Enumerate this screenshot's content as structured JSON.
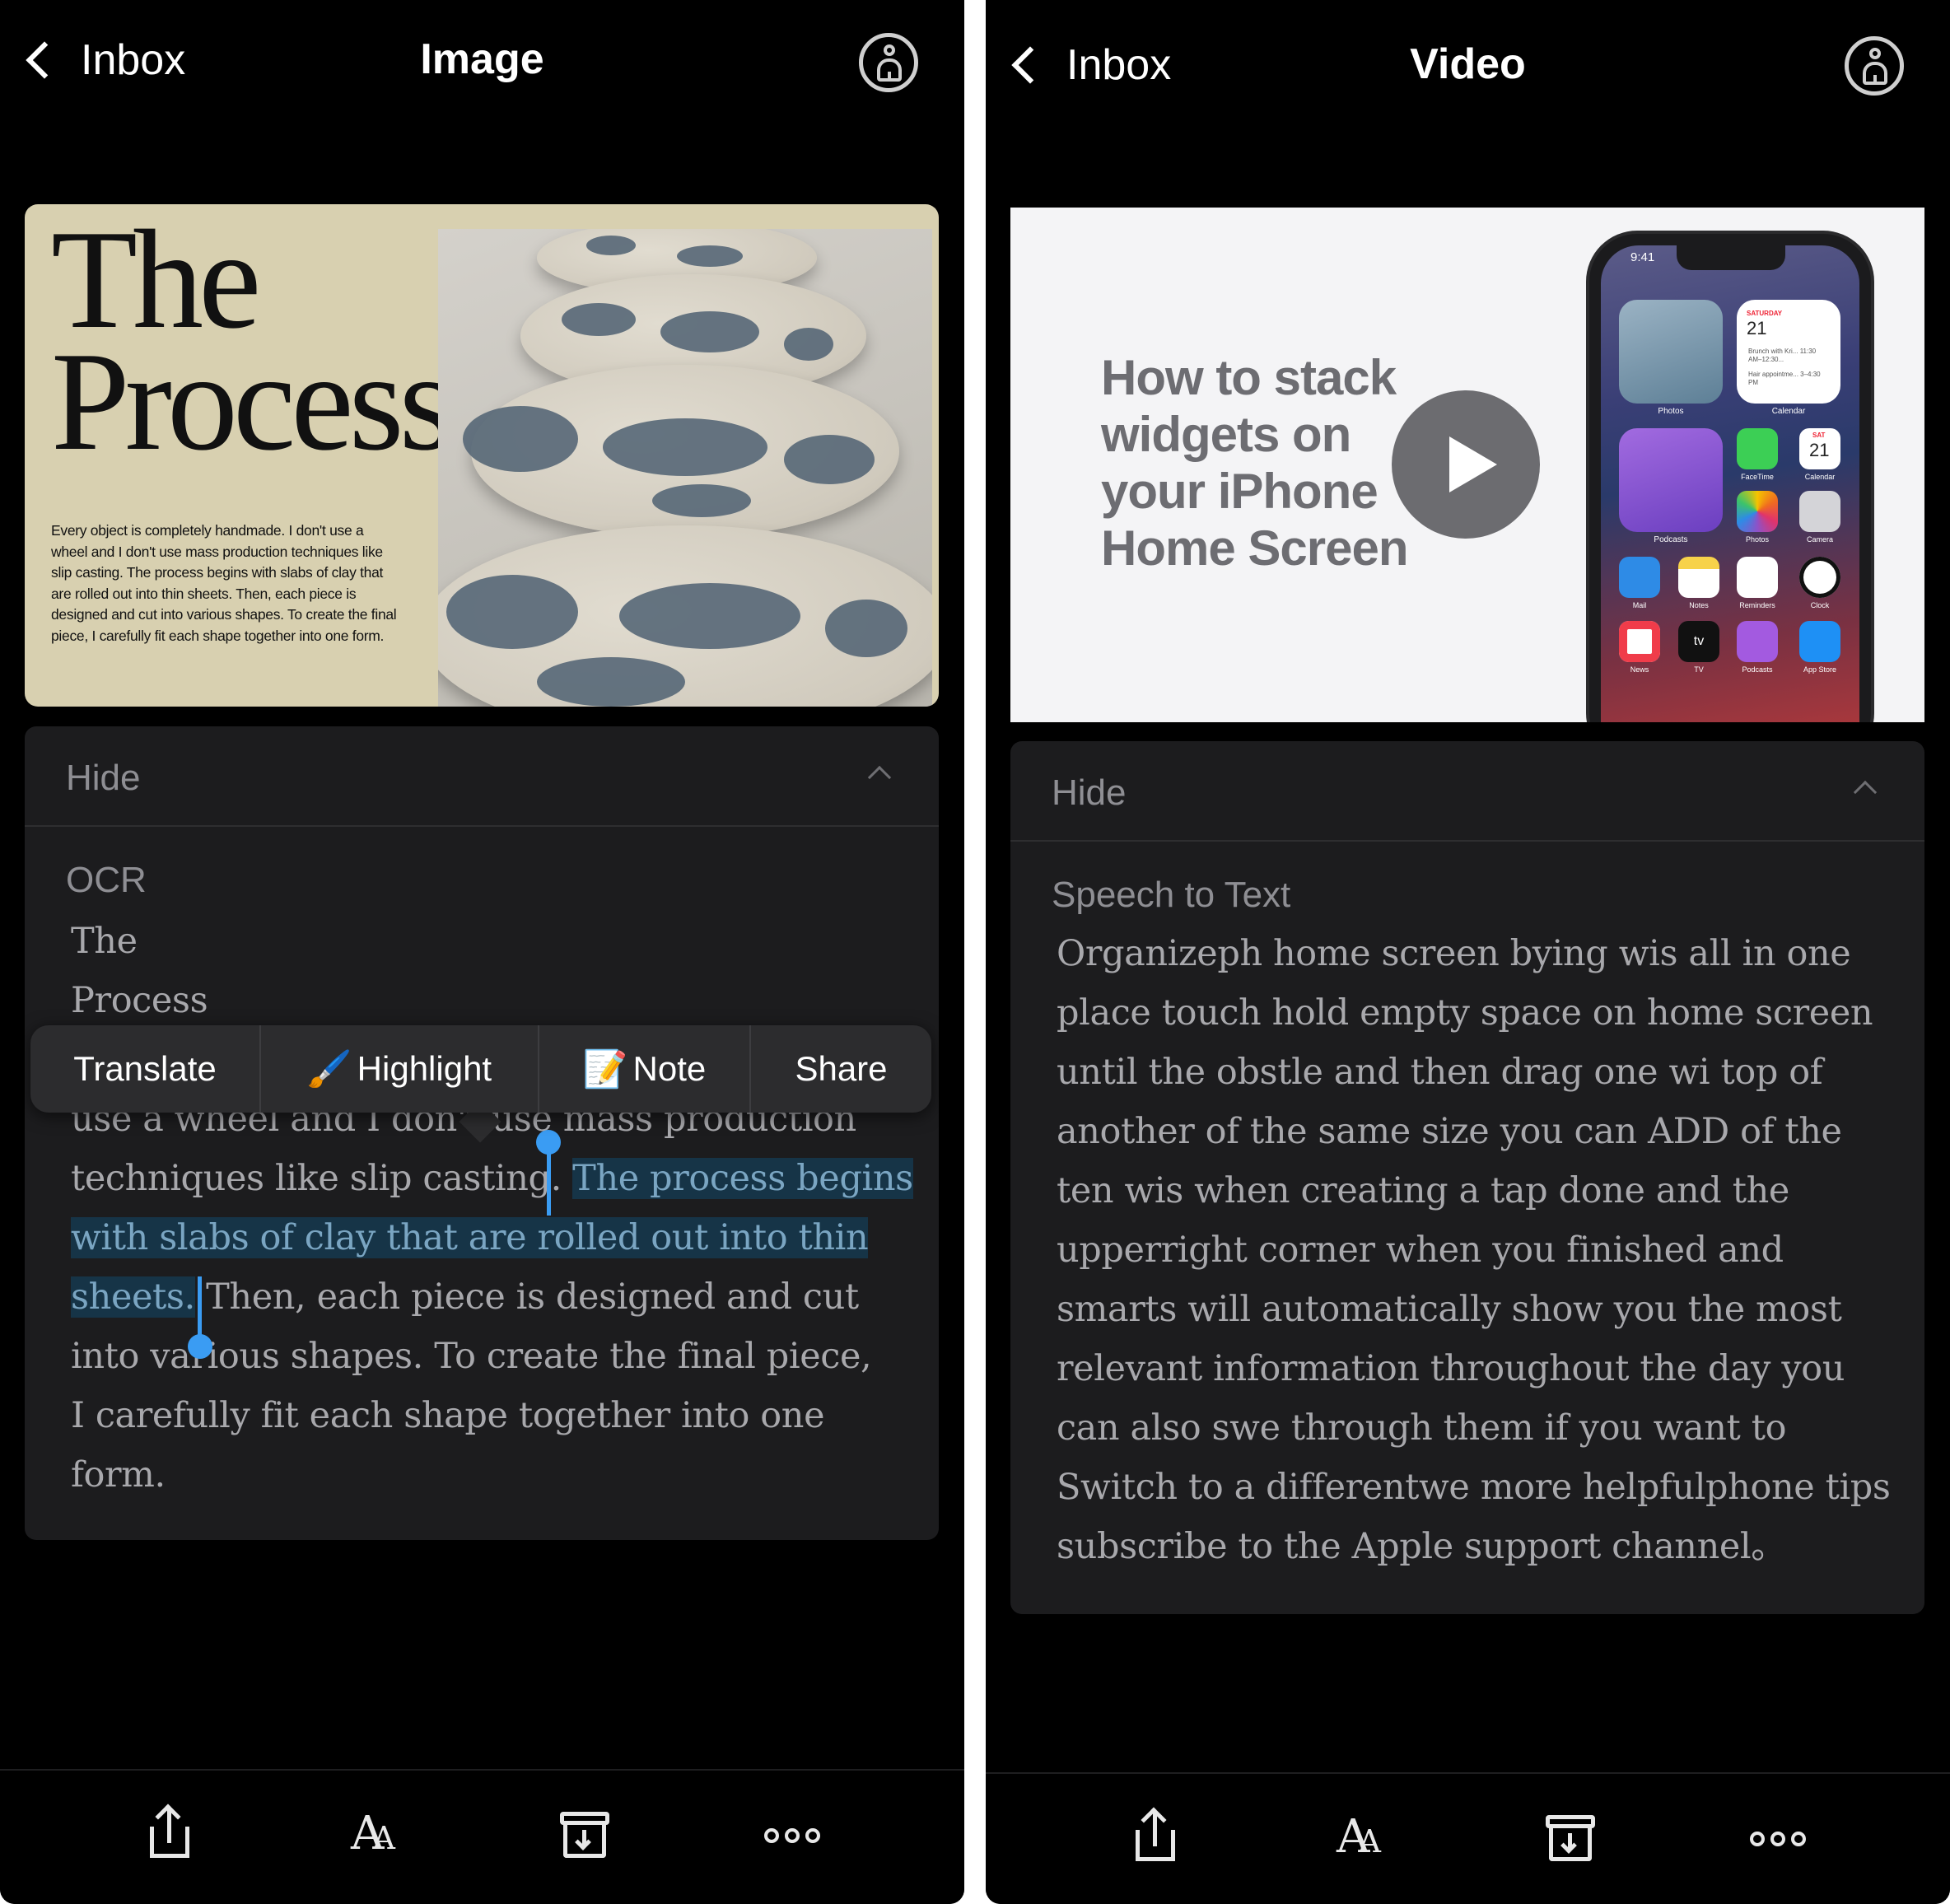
{
  "left": {
    "nav": {
      "back_label": "Inbox",
      "title": "Image"
    },
    "image": {
      "headline_line1": "The",
      "headline_line2": "Process",
      "body": "Every object is completely handmade. I don't use a wheel and I don't use mass production techniques like slip casting. The process begins with slabs of clay that are rolled out into thin sheets. Then, each piece is designed and cut into various shapes. To create the final piece, I carefully fit each shape together into one form."
    },
    "card": {
      "hide_label": "Hide",
      "section_label": "OCR",
      "lines": {
        "l1": "The",
        "l2": "Process",
        "l4": "use a wheel and I don't use mass production",
        "l5a": "techniques like slip casting. ",
        "l5b": "The process begins",
        "l6": "with slabs of clay that are rolled out into thin",
        "l7a": "sheets.",
        "l7b": " Then, each piece is designed and cut",
        "l8": "into various shapes. To create the final piece,",
        "l9": "I carefully fit each shape together into one",
        "l10": "form."
      }
    },
    "context_menu": {
      "translate": "Translate",
      "highlight_emoji": "🖌️",
      "highlight": "Highlight",
      "note_emoji": "📝",
      "note": "Note",
      "share": "Share"
    }
  },
  "right": {
    "nav": {
      "back_label": "Inbox",
      "title": "Video"
    },
    "video": {
      "title": "How to stack widgets on your iPhone Home Screen",
      "phone": {
        "time": "9:41",
        "cal_weekday": "SATURDAY",
        "cal_day": "21",
        "cal_event1": "Brunch with Kri... 11:30 AM–12:30...",
        "cal_event2": "Hair appointme... 3–4:30 PM",
        "photos_label": "Photos",
        "calendar_label": "Calendar",
        "podcasts_label": "Podcasts",
        "app_labels": [
          "FaceTime",
          "Calendar",
          "Photos",
          "Camera",
          "Mail",
          "Notes",
          "Reminders",
          "Clock",
          "News",
          "TV",
          "Podcasts",
          "App Store"
        ],
        "mini_cal_weekday": "SAT",
        "mini_cal_day": "21",
        "tv_glyph": "tv"
      }
    },
    "card": {
      "hide_label": "Hide",
      "section_label": "Speech to Text",
      "lines": [
        "Organizeph home screen bying wis all in one",
        "place touch hold empty space on home screen",
        "until the obstle and then drag one wi top of",
        "another of the same size you can ADD of the",
        "ten wis when creating a tap done and the",
        "upperright corner when you finished and",
        "smarts will automatically show you the most",
        "relevant information throughout the day you",
        "can also swe through them if you want to",
        "Switch to a differentwe more helpfulphone tips",
        "subscribe to the Apple support channel。"
      ]
    }
  },
  "toolbar": {
    "icons": [
      "share-icon",
      "text-format-icon",
      "archive-icon",
      "more-icon"
    ]
  },
  "colors": {
    "background": "#000000",
    "card": "#1c1c1e",
    "selection": "#163447",
    "handle": "#3a9cf3",
    "menu": "#2c2c2e"
  }
}
